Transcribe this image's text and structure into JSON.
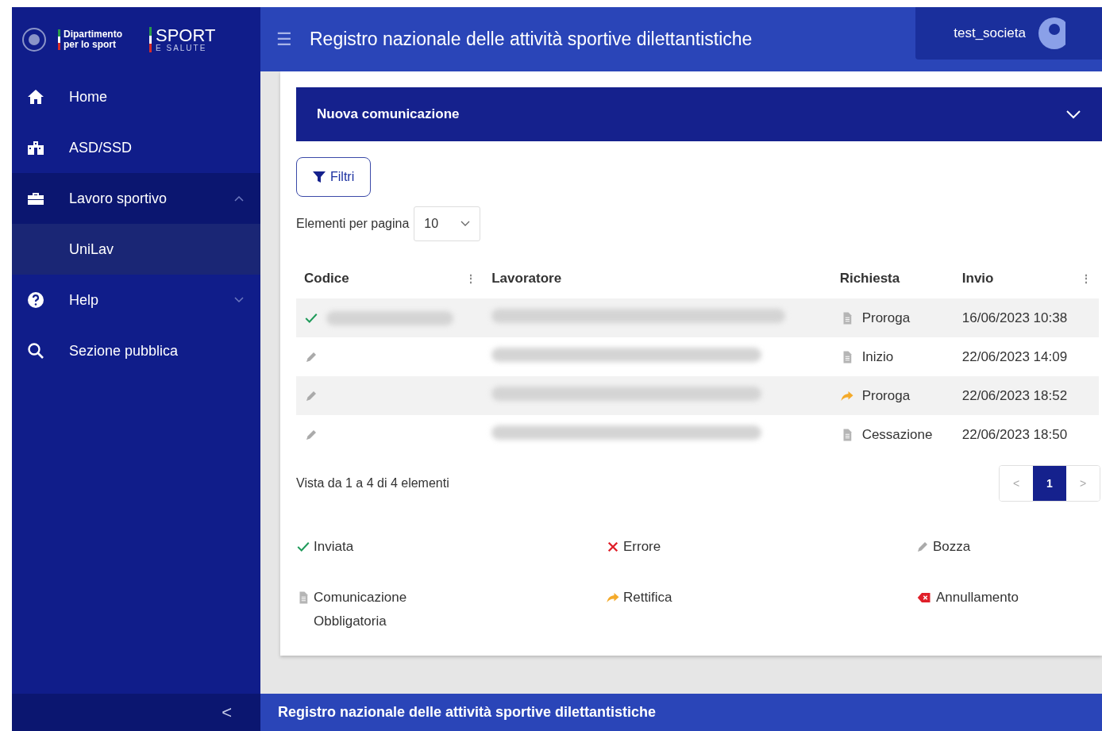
{
  "sidebar": {
    "logo": {
      "ministry_line_1": "Dipartimento",
      "ministry_line_2": "per lo sport",
      "brand": "SPORT",
      "brand_sub": "E SALUTE"
    },
    "items": [
      {
        "label": "Home",
        "selected": false
      },
      {
        "label": "ASD/SSD",
        "selected": false
      },
      {
        "label": "Lavoro sportivo",
        "selected": false,
        "expanded": true,
        "children": [
          {
            "label": "UniLav",
            "selected": true
          }
        ]
      },
      {
        "label": "Help",
        "selected": false,
        "expanded": false
      },
      {
        "label": "Sezione pubblica",
        "selected": false
      }
    ],
    "collapse": "<"
  },
  "header": {
    "menu": "☰",
    "title": "Registro nazionale delle attività sportive dilettantistiche",
    "user": "test_societa"
  },
  "panel": {
    "title": "Nuova comunicazione",
    "expanded": false
  },
  "filters_button": "Filtri",
  "page_size": {
    "label": "Elementi per pagina",
    "value": "10"
  },
  "table": {
    "columns": [
      {
        "label": "Codice",
        "sort": "⋮"
      },
      {
        "label": "Lavoratore"
      },
      {
        "label": "Richiesta"
      },
      {
        "label": "Invio",
        "sort": "⋮"
      }
    ],
    "rows": [
      {
        "status": {
          "kind": "sent"
        },
        "code": {
          "kind": "redacted"
        },
        "worker": {
          "kind": "redacted"
        },
        "request": {
          "kind": "document",
          "label": "Proroga"
        },
        "sent_at": "16/06/2023 10:38"
      },
      {
        "status": {
          "kind": "draft"
        },
        "worker": {
          "kind": "redacted"
        },
        "request": {
          "kind": "document",
          "label": "Inizio"
        },
        "sent_at": "22/06/2023 14:09"
      },
      {
        "status": {
          "kind": "draft"
        },
        "worker": {
          "kind": "redacted"
        },
        "request": {
          "kind": "rectification",
          "label": "Proroga"
        },
        "sent_at": "22/06/2023 18:52"
      },
      {
        "status": {
          "kind": "draft"
        },
        "worker": {
          "kind": "redacted"
        },
        "request": {
          "kind": "document",
          "label": "Cessazione"
        },
        "sent_at": "22/06/2023 18:50"
      }
    ]
  },
  "summary": "Vista da 1 a 4 di 4 elementi",
  "pagination": {
    "prev": "<",
    "pages": [
      {
        "label": "1",
        "selected": true
      }
    ],
    "next": ">"
  },
  "legend": [
    {
      "kind": "sent",
      "label": "Inviata"
    },
    {
      "kind": "error",
      "label": "Errore"
    },
    {
      "kind": "draft",
      "label": "Bozza"
    },
    {
      "kind": "document",
      "label": "Comunicazione Obbligatoria"
    },
    {
      "kind": "rectification",
      "label": "Rettifica"
    },
    {
      "kind": "cancellation",
      "label": "Annullamento"
    }
  ],
  "footer": "Registro nazionale delle attività sportive dilettantistiche"
}
